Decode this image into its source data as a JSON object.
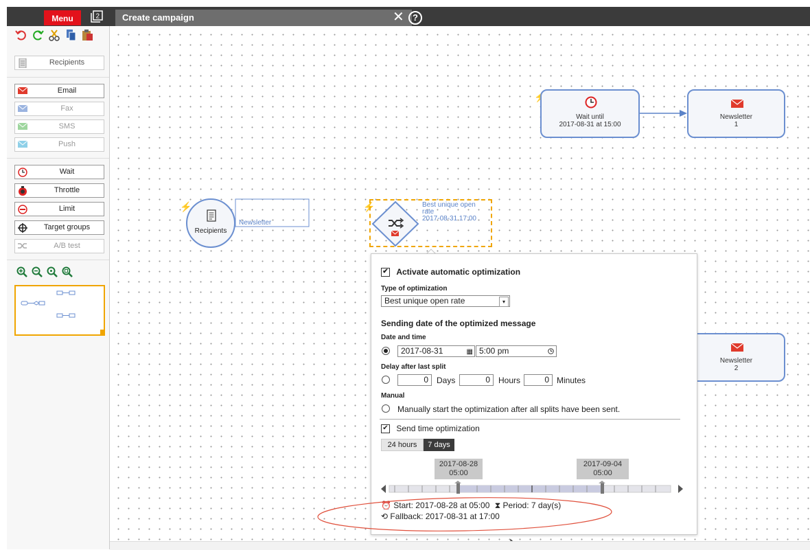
{
  "topbar": {
    "menu_label": "Menu",
    "window_count": "2",
    "tab_title": "Create campaign",
    "close": "✕",
    "help": "?"
  },
  "sidebar": {
    "recipients": "Recipients",
    "channels": [
      {
        "label": "Email",
        "enabled": true
      },
      {
        "label": "Fax",
        "enabled": false
      },
      {
        "label": "SMS",
        "enabled": false
      },
      {
        "label": "Push",
        "enabled": false
      }
    ],
    "controls": [
      {
        "label": "Wait",
        "enabled": true
      },
      {
        "label": "Throttle",
        "enabled": true
      },
      {
        "label": "Limit",
        "enabled": true
      },
      {
        "label": "Target groups",
        "enabled": true
      },
      {
        "label": "A/B test",
        "enabled": false
      }
    ]
  },
  "canvas": {
    "recipients_node": {
      "label": "Recipients",
      "name": "Newsletter"
    },
    "ab_node": {
      "line1": "Best unique open",
      "line2": "rate",
      "line3": "2017-08-31 17:00"
    },
    "wait_node": {
      "line1": "Wait until",
      "line2": "2017-08-31 at 15:00"
    },
    "newsletter1": {
      "line1": "Newsletter",
      "line2": "1"
    },
    "newsletter2": {
      "line1": "Newsletter",
      "line2": "2"
    }
  },
  "popup": {
    "activate_label": "Activate automatic optimization",
    "type_label": "Type of optimization",
    "type_value": "Best unique open rate",
    "sending_title": "Sending date of the optimized message",
    "datetime_label": "Date and time",
    "date_value": "2017-08-31",
    "time_value": "5:00 pm",
    "delay_label": "Delay after last split",
    "days_value": "0",
    "days_unit": "Days",
    "hours_value": "0",
    "hours_unit": "Hours",
    "minutes_value": "0",
    "minutes_unit": "Minutes",
    "manual_label": "Manual",
    "manual_text": "Manually start the optimization after all splits have been sent.",
    "sto_label": "Send time optimization",
    "tab_24h": "24 hours",
    "tab_7d": "7 days",
    "marker_start_date": "2017-08-28",
    "marker_start_time": "05:00",
    "marker_end_date": "2017-09-04",
    "marker_end_time": "05:00",
    "start_text": "Start: 2017-08-28 at 05:00",
    "period_text": "Period: 7 day(s)",
    "fallback_text": "Fallback: 2017-08-31 at 17:00"
  },
  "colors": {
    "accent": "#e3121b",
    "node_border": "#6b8fd0",
    "highlight": "#f0a500",
    "annotation": "#e0503c"
  }
}
